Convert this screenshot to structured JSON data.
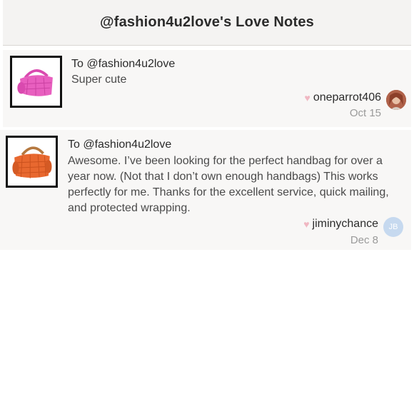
{
  "header": {
    "title": "@fashion4u2love's Love Notes"
  },
  "notes": [
    {
      "to": "To @fashion4u2love",
      "message": "Super cute",
      "author": "oneparrot406",
      "date": "Oct 15",
      "avatar": {
        "type": "photo",
        "icon": "user-photo-avatar"
      },
      "thumbnail": {
        "icon": "pink-handbag-thumbnail",
        "color": "#e85fbf"
      }
    },
    {
      "to": "To @fashion4u2love",
      "message": "Awesome. I’ve been looking for the perfect handbag for over a year now. (Not that I don’t own enough handbags) This works perfectly for me. Thanks for the excellent service, quick mailing, and protected wrapping.",
      "author": "jiminychance",
      "date": "Dec 8",
      "avatar": {
        "type": "initials",
        "initials": "JB",
        "color": "#c6d9ef"
      },
      "thumbnail": {
        "icon": "orange-handbag-thumbnail",
        "color": "#e8682f"
      }
    }
  ],
  "colors": {
    "heart": "#f0b7c2",
    "header_bg": "#f4f3f2",
    "note_bg": "#f8f7f6",
    "date_text": "#9a9a9a"
  }
}
